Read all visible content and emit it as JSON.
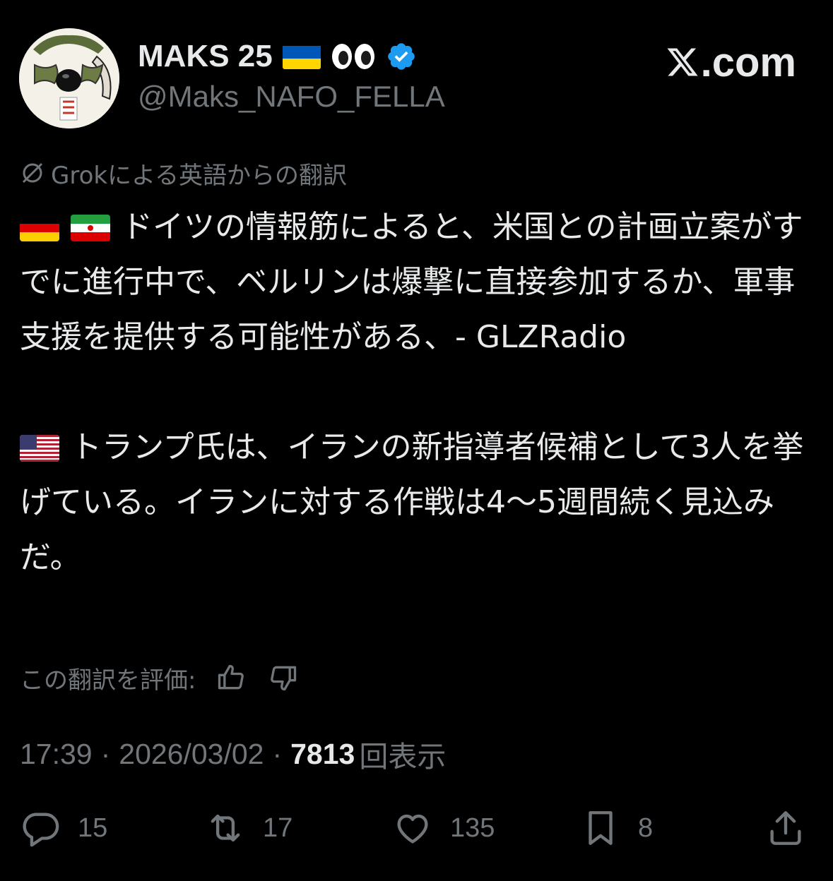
{
  "author": {
    "display_name": "MAKS 25",
    "handle": "@Maks_NAFO_FELLA",
    "verified": true
  },
  "brand": {
    "label": ".com"
  },
  "translation": {
    "note": "Grokによる英語からの翻訳",
    "rate_label": "この翻訳を評価:"
  },
  "tweet": {
    "paragraph_1": "ドイツの情報筋によると、米国との計画立案がすでに進行中で、ベルリンは爆撃に直接参加するか、軍事支援を提供する可能性がある、- GLZRadio",
    "paragraph_2": "トランプ氏は、イランの新指導者候補として3人を挙げている。イランに対する作戦は4～5週間続く見込みだ。"
  },
  "meta": {
    "time": "17:39",
    "separator": "·",
    "date": "2026/03/02",
    "views_count": "7813",
    "views_label": "回表示"
  },
  "actions": {
    "replies": "15",
    "reposts": "17",
    "likes": "135",
    "bookmarks": "8"
  },
  "icons": {
    "verified": "verified-badge-icon",
    "reply": "reply-icon",
    "repost": "repost-icon",
    "like": "heart-icon",
    "bookmark": "bookmark-icon",
    "share": "share-icon",
    "thumbs_up": "thumbs-up-icon",
    "thumbs_down": "thumbs-down-icon",
    "translate": "translate-icon"
  },
  "colors": {
    "background": "#000000",
    "text_primary": "#e7e9ea",
    "text_secondary": "#71767b",
    "verified_blue": "#1d9bf0"
  }
}
